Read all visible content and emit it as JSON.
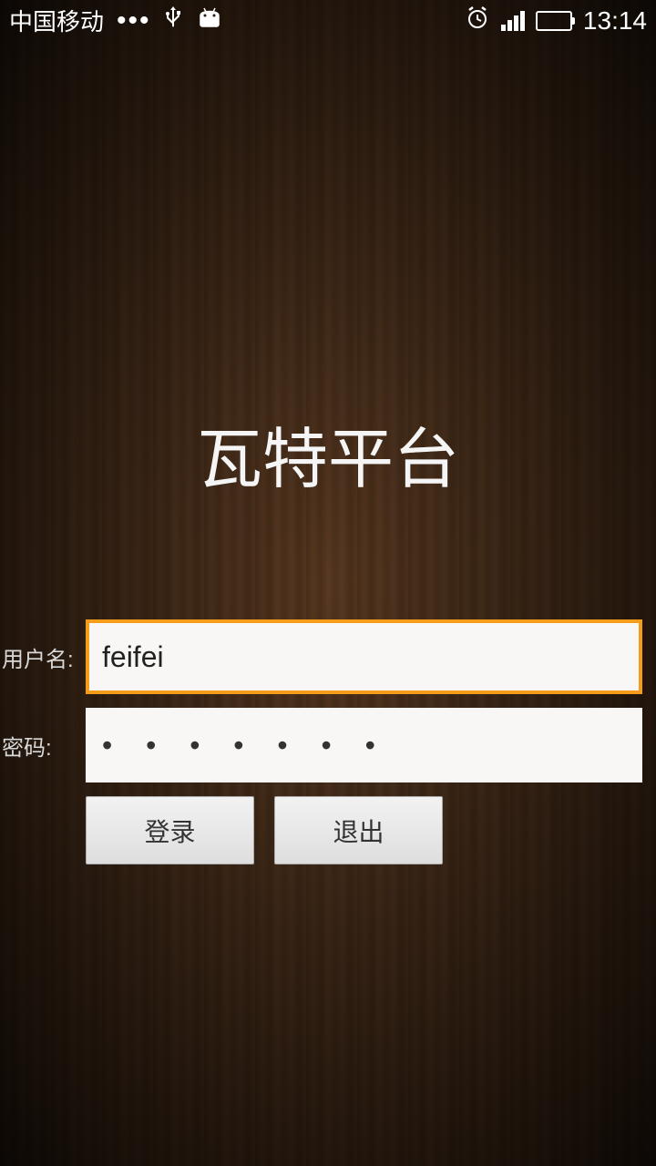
{
  "status_bar": {
    "carrier": "中国移动",
    "dots": "•••",
    "time": "13:14"
  },
  "app": {
    "title": "瓦特平台"
  },
  "form": {
    "username_label": "用户名:",
    "username_value": "feifei",
    "password_label": "密码:",
    "password_display": "• • • • • • •"
  },
  "buttons": {
    "login": "登录",
    "exit": "退出"
  }
}
